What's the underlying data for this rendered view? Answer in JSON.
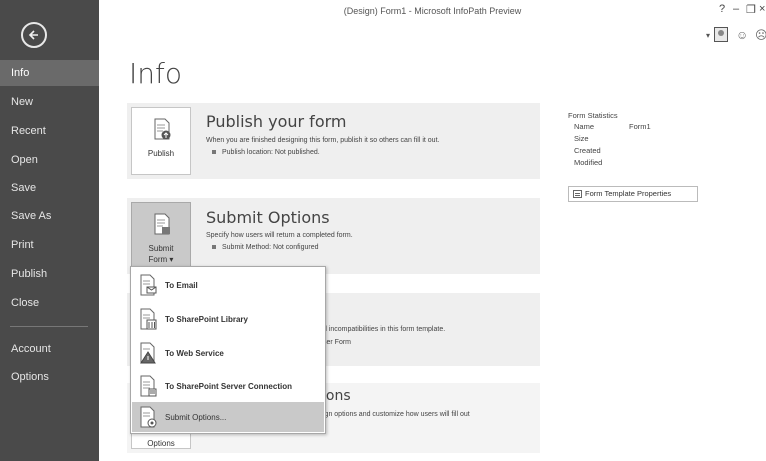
{
  "window": {
    "title": "(Design) Form1 - Microsoft InfoPath Preview",
    "help": "?",
    "minimize": "–",
    "restore": "❐",
    "close": "×"
  },
  "sidebar": {
    "items": [
      {
        "label": "Info",
        "active": true
      },
      {
        "label": "New"
      },
      {
        "label": "Recent"
      },
      {
        "label": "Open"
      },
      {
        "label": "Save"
      },
      {
        "label": "Save As"
      },
      {
        "label": "Print"
      },
      {
        "label": "Publish"
      },
      {
        "label": "Close"
      },
      {
        "label": "Account"
      },
      {
        "label": "Options"
      }
    ]
  },
  "main": {
    "title": "Info",
    "publish": {
      "button_label": "Publish",
      "heading": "Publish your form",
      "description": "When you are finished designing this form, publish it so others can fill it out.",
      "bullet": "Publish location: Not published."
    },
    "submit": {
      "button_line1": "Submit",
      "button_line2": "Form ▾",
      "heading": "Submit Options",
      "description": "Specify how users will return a completed form.",
      "bullet": "Submit Method: Not configured"
    },
    "design_checker": {
      "text1": "d incompatibilities in this form template.",
      "text2": "ser Form"
    },
    "advanced": {
      "heading_partial": "ions",
      "text": "ign options and customize how users will fill out",
      "button_partial": "Options"
    }
  },
  "stats": {
    "header": "Form Statistics",
    "rows": [
      {
        "label": "Name",
        "value": "Form1"
      },
      {
        "label": "Size",
        "value": ""
      },
      {
        "label": "Created",
        "value": ""
      },
      {
        "label": "Modified",
        "value": ""
      }
    ],
    "properties_button": "Form Template Properties"
  },
  "menu": {
    "items": [
      {
        "label": "To Email"
      },
      {
        "label": "To SharePoint Library"
      },
      {
        "label": "To Web Service"
      },
      {
        "label": "To SharePoint Server Connection"
      },
      {
        "label": "Submit Options...",
        "highlighted": true
      }
    ]
  },
  "colors": {
    "sidebar_bg": "#4a4a4a",
    "sidebar_active": "#6a6a6a",
    "card_bg": "#efefef",
    "menu_highlight": "#c9c9c9"
  }
}
